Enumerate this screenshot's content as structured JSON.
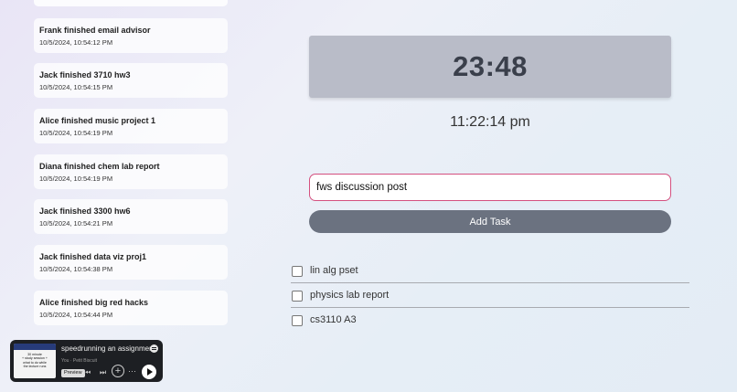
{
  "feed": {
    "items": [
      {
        "text": "Frank finished email advisor",
        "time": "10/5/2024, 10:54:12 PM"
      },
      {
        "text": "Jack finished 3710 hw3",
        "time": "10/5/2024, 10:54:15 PM"
      },
      {
        "text": "Alice finished music project 1",
        "time": "10/5/2024, 10:54:19 PM"
      },
      {
        "text": "Diana finished chem lab report",
        "time": "10/5/2024, 10:54:19 PM"
      },
      {
        "text": "Jack finished 3300 hw6",
        "time": "10/5/2024, 10:54:21 PM"
      },
      {
        "text": "Jack finished data viz proj1",
        "time": "10/5/2024, 10:54:38 PM"
      },
      {
        "text": "Alice finished big red hacks",
        "time": "10/5/2024, 10:54:44 PM"
      }
    ]
  },
  "timer": {
    "value": "23:48"
  },
  "clock": {
    "time": "11:22:14 pm"
  },
  "task_input": {
    "value": "fws discussion post"
  },
  "add_button": {
    "label": "Add Task"
  },
  "tasks": [
    {
      "label": "lin alg pset",
      "checked": false
    },
    {
      "label": "physics lab report",
      "checked": false
    },
    {
      "label": "cs3110 A3",
      "checked": false
    }
  ],
  "player": {
    "track_title": "speedrunning an assignment",
    "artist": "You · Petit Biscuit",
    "preview_label": "Preview",
    "thumbnail_text": "30 minute\n+ study session +\nwhat to do while\nthe lecture runs",
    "controls_more": "···"
  },
  "colors": {
    "timer_bg": "#b9bcc8",
    "input_border": "#d4507f",
    "button_bg": "#6b7280",
    "player_bg": "#1d1f23"
  }
}
